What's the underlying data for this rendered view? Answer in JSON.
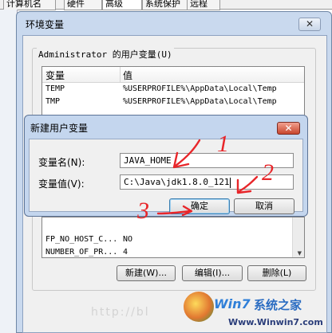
{
  "background_window": {
    "tabs": [
      "计算机名",
      "硬件",
      "高级",
      "系统保护",
      "远程"
    ]
  },
  "env_window": {
    "title": "环境变量",
    "close_glyph": "✕",
    "user_group_label": "Administrator 的用户变量(U)",
    "user_list": {
      "headers": [
        "变量",
        "值"
      ],
      "rows": [
        {
          "name": "TEMP",
          "value": "%USERPROFILE%\\AppData\\Local\\Temp"
        },
        {
          "name": "TMP",
          "value": "%USERPROFILE%\\AppData\\Local\\Temp"
        }
      ]
    },
    "system_list": {
      "rows": [
        {
          "name": "FP_NO_HOST_C...",
          "value": "NO"
        },
        {
          "name": "NUMBER_OF_PR...",
          "value": "4"
        }
      ]
    },
    "buttons": {
      "new": "新建(W)...",
      "edit": "编辑(I)...",
      "delete": "删除(L)"
    }
  },
  "new_var_dialog": {
    "title": "新建用户变量",
    "close_glyph": "✕",
    "name_label": "变量名(N):",
    "name_value": "JAVA_HOME",
    "value_label": "变量值(V):",
    "value_value": "C:\\Java\\jdk1.8.0_121",
    "ok_button": "确定",
    "cancel_button": "取消"
  },
  "annotations": {
    "one": "1",
    "two": "2",
    "three": "3",
    "color": "#e8262a"
  },
  "watermark": {
    "text": "http://bl",
    "brand": "Win7",
    "brand_cn": "系统之家",
    "url": "Www.Winwin7.com"
  }
}
